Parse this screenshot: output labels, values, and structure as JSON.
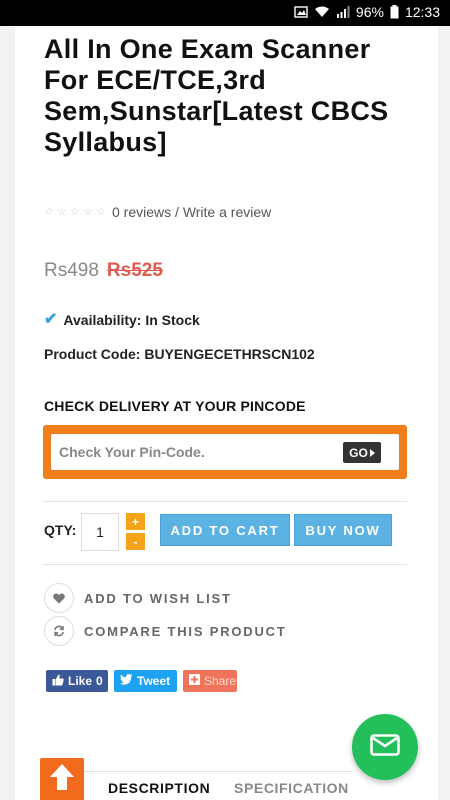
{
  "status_bar": {
    "battery": "96%",
    "time": "12:33"
  },
  "product": {
    "title": "All In One Exam Scanner For ECE/TCE,3rd Sem,Sunstar[Latest CBCS Syllabus]",
    "rating": 0,
    "reviews_text": "0 reviews",
    "separator": " / ",
    "write_review": "Write a review",
    "price_new": "Rs498",
    "price_old": "Rs525",
    "availability": "Availability: In Stock",
    "product_code": "Product Code: BUYENGECETHRSCN102"
  },
  "delivery": {
    "heading": "CHECK DELIVERY AT YOUR PINCODE",
    "placeholder": "Check Your Pin-Code.",
    "go_label": "GO"
  },
  "purchase": {
    "qty_label": "QTY:",
    "qty_value": "1",
    "plus": "+",
    "minus": "-",
    "add_to_cart": "ADD TO CART",
    "buy_now": "BUY NOW"
  },
  "actions": {
    "wishlist": "ADD TO WISH LIST",
    "compare": "COMPARE THIS PRODUCT"
  },
  "social": {
    "fb_like": "Like",
    "fb_count": "0",
    "tweet": "Tweet",
    "share": "Share"
  },
  "tabs": [
    {
      "label": "DESCRIPTION",
      "active": true
    },
    {
      "label": "SPECIFICATION",
      "active": false
    }
  ],
  "colors": {
    "accent_orange": "#f07e1b",
    "button_blue": "#5cb3e3",
    "price_old_red": "#e05a4f",
    "fab_green": "#22bf5b"
  }
}
